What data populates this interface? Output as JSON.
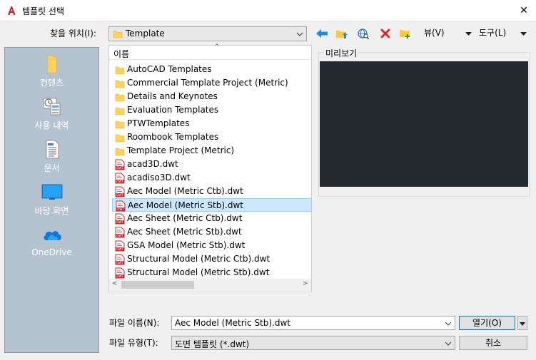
{
  "window": {
    "title": "템플릿 선택",
    "close_glyph": "✕",
    "app_icon": "autocad-a-icon"
  },
  "toolbar": {
    "lookin_label": "찾을 위치(I):",
    "lookin_value": "Template",
    "back_icon": "back-arrow-icon",
    "up_icon": "up-one-level-icon",
    "web_icon": "search-web-icon",
    "delete_icon": "delete-icon",
    "newfolder_icon": "create-new-folder-icon",
    "view_label": "뷰(V)",
    "tools_label": "도구(L)"
  },
  "places": [
    {
      "label": "컨텐츠",
      "icon": "folder-icon"
    },
    {
      "label": "사용 내역",
      "icon": "history-icon"
    },
    {
      "label": "문서",
      "icon": "documents-icon"
    },
    {
      "label": "바탕 화면",
      "icon": "desktop-icon"
    },
    {
      "label": "OneDrive",
      "icon": "onedrive-icon"
    }
  ],
  "filelist": {
    "column_header": "이름",
    "items": [
      {
        "name": "AutoCAD Templates",
        "type": "folder"
      },
      {
        "name": "Commercial Template Project (Metric)",
        "type": "folder"
      },
      {
        "name": "Details and Keynotes",
        "type": "folder"
      },
      {
        "name": "Evaluation Templates",
        "type": "folder"
      },
      {
        "name": "PTWTemplates",
        "type": "folder"
      },
      {
        "name": "Roombook Templates",
        "type": "folder"
      },
      {
        "name": "Template Project (Metric)",
        "type": "folder"
      },
      {
        "name": "acad3D.dwt",
        "type": "dwt"
      },
      {
        "name": "acadiso3D.dwt",
        "type": "dwt"
      },
      {
        "name": "Aec Model (Metric Ctb).dwt",
        "type": "dwt"
      },
      {
        "name": "Aec Model (Metric Stb).dwt",
        "type": "dwt",
        "selected": true
      },
      {
        "name": "Aec Sheet (Metric Ctb).dwt",
        "type": "dwt"
      },
      {
        "name": "Aec Sheet (Metric Stb).dwt",
        "type": "dwt"
      },
      {
        "name": "GSA Model (Metric Stb).dwt",
        "type": "dwt"
      },
      {
        "name": "Structural Model (Metric Ctb).dwt",
        "type": "dwt"
      },
      {
        "name": "Structural Model (Metric Stb).dwt",
        "type": "dwt"
      }
    ]
  },
  "preview": {
    "label": "미리보기"
  },
  "footer": {
    "filename_label": "파일 이름(N):",
    "filename_value": "Aec Model (Metric Stb).dwt",
    "filetype_label": "파일 유형(T):",
    "filetype_value": "도면 템플릿 (*.dwt)",
    "open_label": "열기(O)",
    "cancel_label": "취소"
  },
  "colors": {
    "places_bg": "#b5c3d1",
    "preview_bg": "#252a31",
    "selection": "#cce8ff",
    "folder": "#ffd35c",
    "dwt_red": "#c5282f",
    "accent_blue": "#0078d7"
  }
}
